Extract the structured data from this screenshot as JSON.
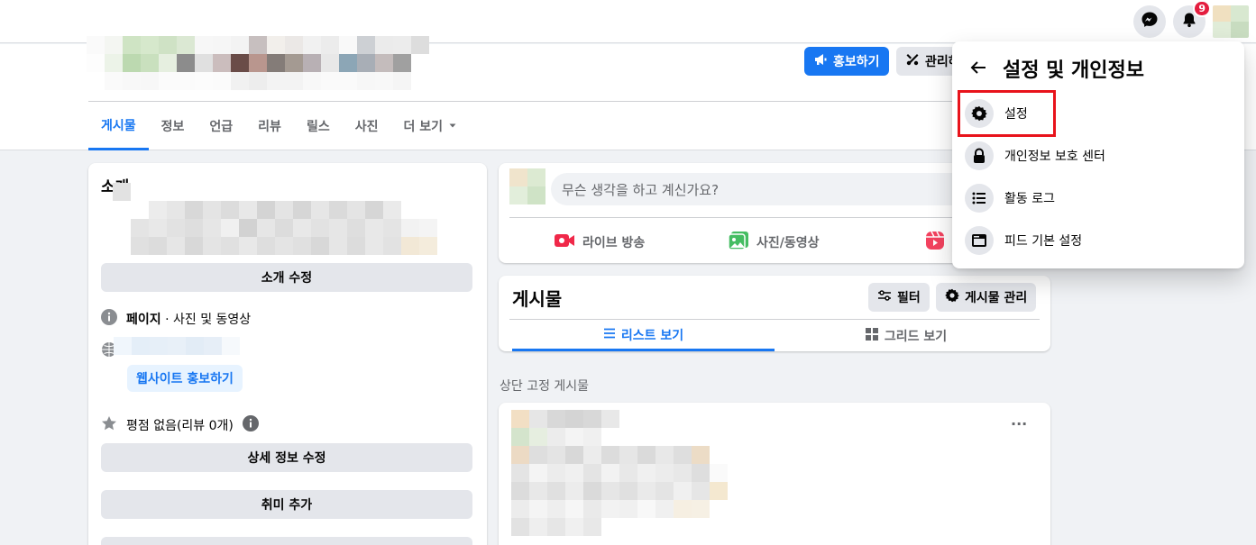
{
  "topbar": {
    "messenger_icon": "messenger-icon",
    "notification_icon": "bell-icon",
    "notification_count": "9"
  },
  "header": {
    "promote_label": "홍보하기",
    "manage_label": "관리하",
    "tabs": [
      {
        "label": "게시물"
      },
      {
        "label": "정보"
      },
      {
        "label": "언급"
      },
      {
        "label": "리뷰"
      },
      {
        "label": "릴스"
      },
      {
        "label": "사진"
      },
      {
        "label": "더 보기"
      }
    ]
  },
  "intro": {
    "title": "소개",
    "edit_intro_label": "소개 수정",
    "page_category_bold": "페이지",
    "page_category_rest": " · 사진 및 동영상",
    "promote_website_label": "웹사이트 홍보하기",
    "rating_text": "평점 없음(리뷰 0개)",
    "edit_details_label": "상세 정보 수정",
    "add_hobbies_label": "취미 추가"
  },
  "composer": {
    "placeholder": "무슨 생각을 하고 계신가요?",
    "live_label": "라이브 방송",
    "photo_label": "사진/동영상"
  },
  "posts": {
    "title": "게시물",
    "filter_label": "필터",
    "manage_posts_label": "게시물 관리",
    "list_view_label": "리스트 보기",
    "grid_view_label": "그리드 보기",
    "pinned_label": "상단 고정 게시물",
    "more_label": "···"
  },
  "menu": {
    "title": "설정 및 개인정보",
    "items": [
      {
        "label": "설정",
        "icon": "gear-icon"
      },
      {
        "label": "개인정보 보호 센터",
        "icon": "lock-icon"
      },
      {
        "label": "활동 로그",
        "icon": "list-icon"
      },
      {
        "label": "피드 기본 설정",
        "icon": "feed-icon"
      }
    ]
  },
  "colors": {
    "accent": "#1877f2",
    "highlight": "#e8131b",
    "badge": "#e41e3f"
  }
}
